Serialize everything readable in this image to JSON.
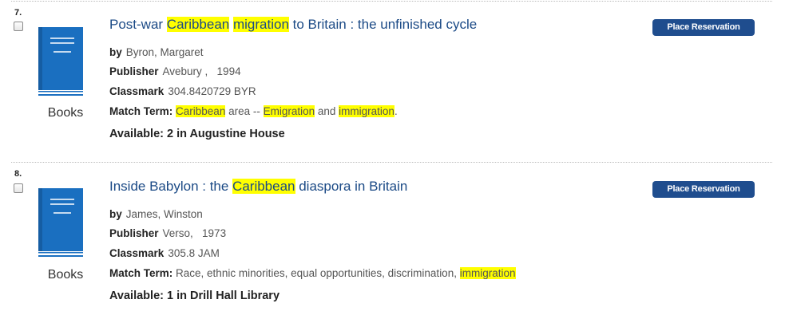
{
  "records": [
    {
      "number": "7.",
      "title": {
        "pre": "Post-war ",
        "hl1": "Caribbean",
        "mid1": " ",
        "hl2": "migration",
        "post": " to Britain : the unfinished cycle"
      },
      "by_label": "by",
      "by_value": "Byron, Margaret",
      "publisher_label": "Publisher",
      "publisher_value": "Avebury ,   1994",
      "classmark_label": "Classmark",
      "classmark_value": "304.8420729 BYR",
      "match_label": "Match Term:",
      "match": {
        "h1": "Caribbean",
        "t1": " area -- ",
        "h2": "Emigration",
        "t2": " and ",
        "h3": "immigration",
        "t3": "."
      },
      "format": "Books",
      "availability": "Available: 2 in Augustine House",
      "button": "Place Reservation"
    },
    {
      "number": "8.",
      "title": {
        "pre": "Inside Babylon : the ",
        "hl1": "Caribbean",
        "post": " diaspora in Britain"
      },
      "by_label": "by",
      "by_value": "James, Winston",
      "publisher_label": "Publisher",
      "publisher_value": "Verso,   1973",
      "classmark_label": "Classmark",
      "classmark_value": "305.8 JAM",
      "match_label": "Match Term:",
      "match": {
        "t1": "Race, ethnic minorities, equal opportunities, discrimination, ",
        "h1": "immigration"
      },
      "format": "Books",
      "availability": "Available: 1 in Drill Hall Library",
      "button": "Place Reservation"
    }
  ],
  "colors": {
    "highlight": "#ffff00",
    "title": "#1b4a86",
    "button": "#1f4d8e",
    "book_icon": "#1a6fc0"
  },
  "icons": {
    "book": "book-icon"
  }
}
